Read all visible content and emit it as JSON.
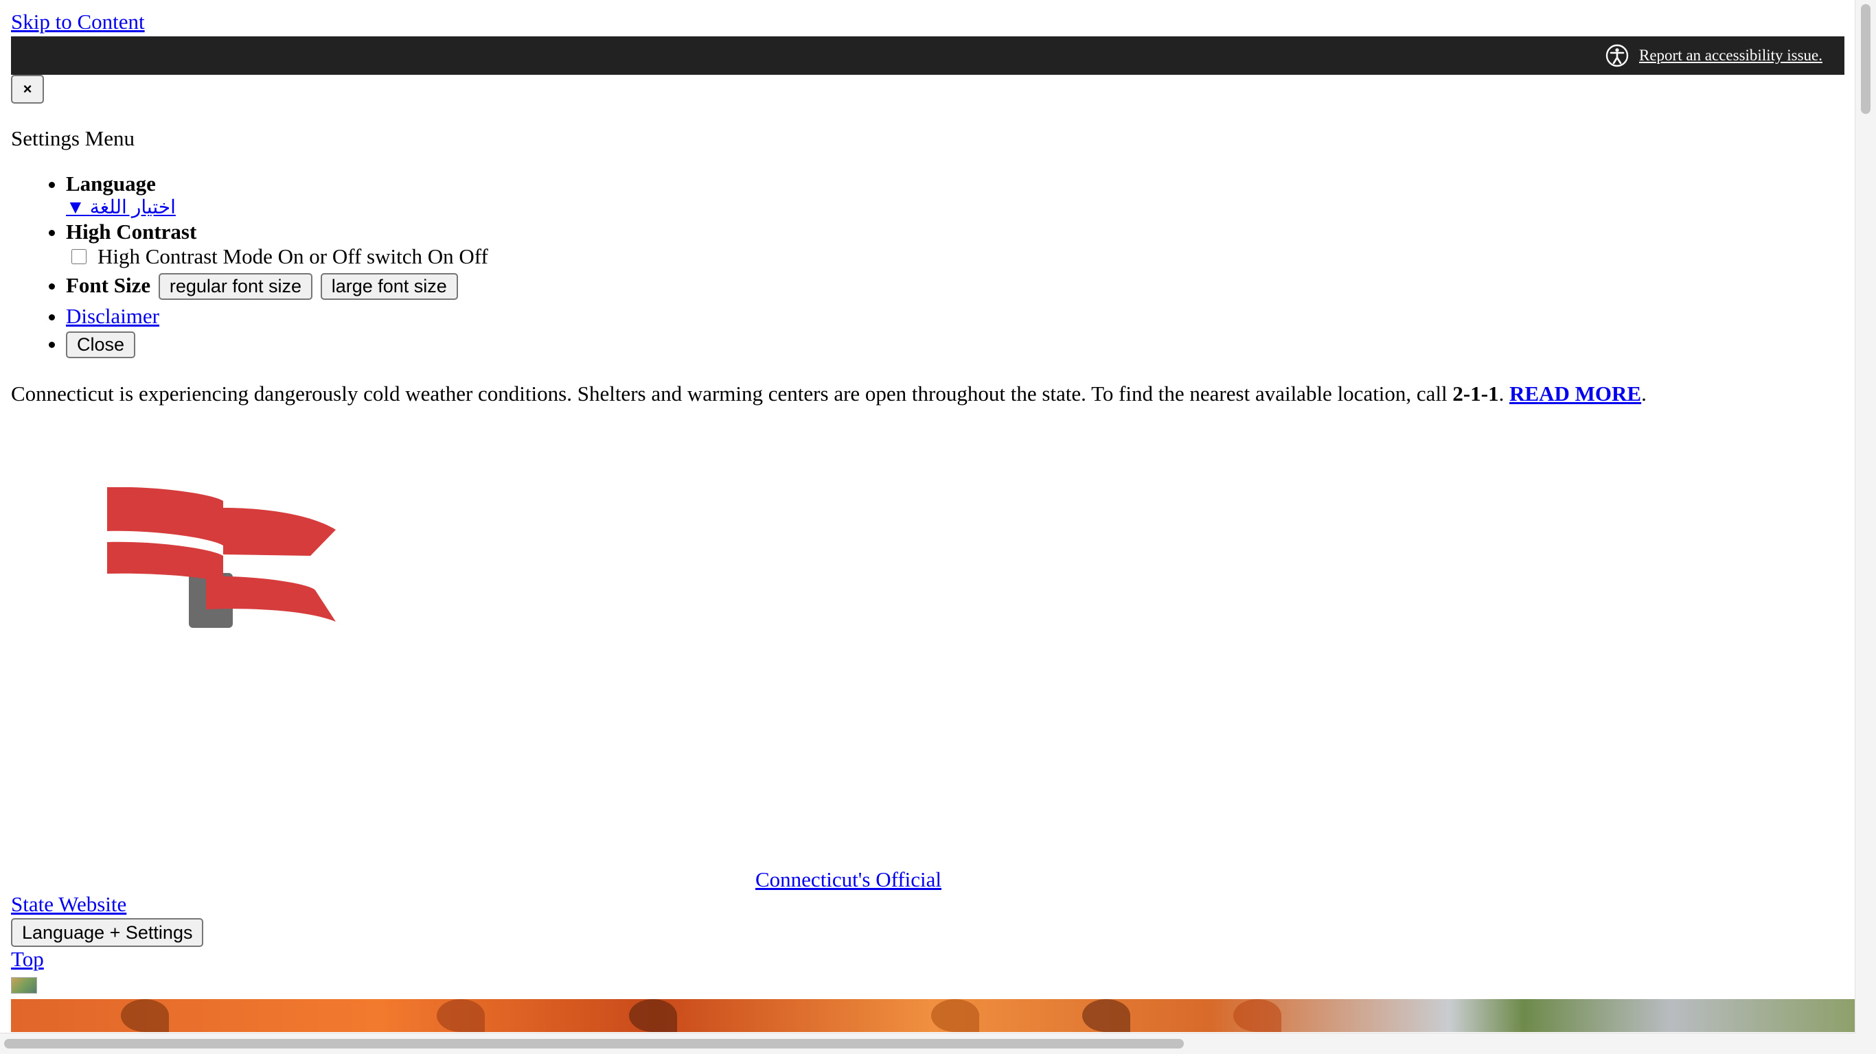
{
  "skip_link": "Skip to Content",
  "a11y_bar": {
    "report_link": "Report an accessibility issue.",
    "icon": "accessibility-icon"
  },
  "close_x": "×",
  "settings": {
    "title": "Settings Menu",
    "language_label": "Language",
    "language_link": "▼ اختيار اللغة",
    "high_contrast_label": "High Contrast",
    "high_contrast_switch_text": "High Contrast Mode On or Off switch On Off",
    "font_size_label": "Font Size",
    "regular_font_btn": "regular font size",
    "large_font_btn": "large font size",
    "disclaimer_link": "Disclaimer",
    "close_btn": "Close"
  },
  "alert": {
    "text_before": "Connecticut is experiencing dangerously cold weather conditions. Shelters and warming centers are open throughout the state. To find the nearest available location, call ",
    "phone": "2-1-1",
    "sep": ". ",
    "read_more": "READ MORE",
    "end": "."
  },
  "logo": {
    "icon": "ct-flag-logo",
    "colors": {
      "red": "#d63c3c",
      "gray": "#6b6b6b"
    }
  },
  "official_link": " Connecticut's Official",
  "state_website_link": "State Website",
  "lang_settings_btn": "Language + Settings",
  "top_link": "Top",
  "bar_color": "#222222"
}
